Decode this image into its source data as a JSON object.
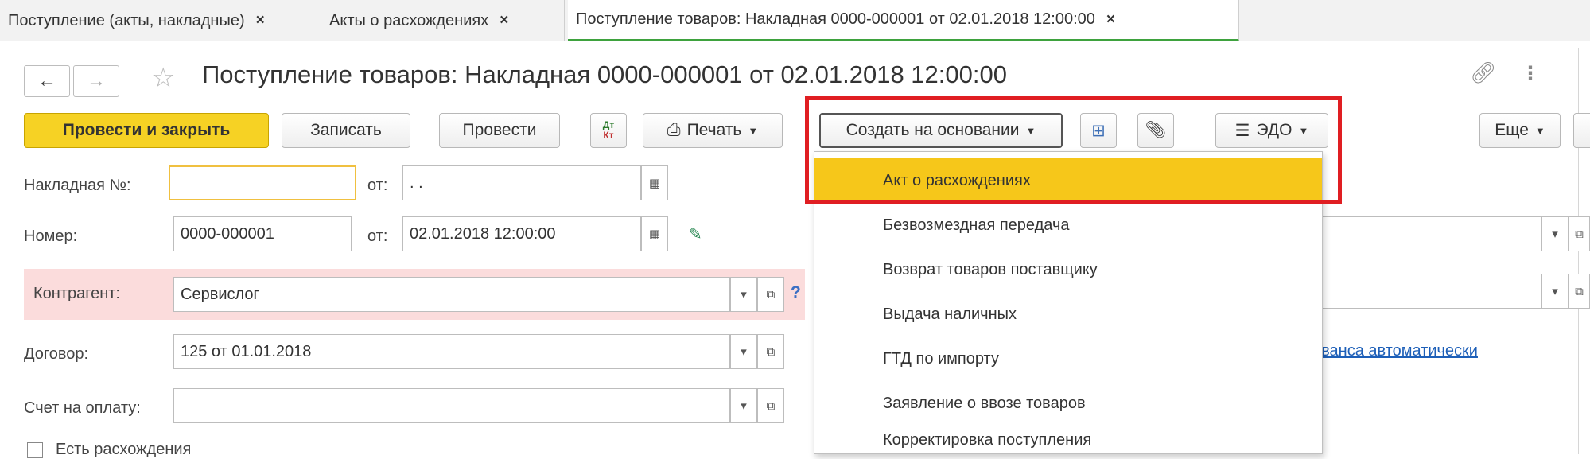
{
  "tabs": [
    {
      "label": "Поступление (акты, накладные)"
    },
    {
      "label": "Акты о расхождениях"
    },
    {
      "label": "Поступление товаров: Накладная 0000-000001 от 02.01.2018 12:00:00"
    }
  ],
  "title": "Поступление товаров: Накладная 0000-000001 от 02.01.2018 12:00:00",
  "toolbar": {
    "post_close": "Провести и закрыть",
    "save": "Записать",
    "post": "Провести",
    "dtkt_top": "Дт",
    "dtkt_bottom": "Кт",
    "print": "Печать",
    "create_based": "Создать на основании",
    "edo": "ЭДО",
    "more": "Еще"
  },
  "form": {
    "invoice_label": "Накладная №:",
    "invoice_value": "",
    "from_label": "от:",
    "invoice_date": " .  .",
    "number_label": "Номер:",
    "number_value": "0000-000001",
    "number_date": "02.01.2018 12:00:00",
    "counterparty_label": "Контрагент:",
    "counterparty_value": "Сервислог",
    "help_mark": "?",
    "contract_label": "Договор:",
    "contract_value": "125 от 01.01.2018",
    "payment_label": "Счет на оплату:",
    "payment_value": "",
    "discrepancy_label": "Есть расхождения",
    "advance_link": "аванса автоматически"
  },
  "menu_items": [
    "Акт о расхождениях",
    "Безвозмездная передача",
    "Возврат товаров поставщику",
    "Выдача наличных",
    "ГТД по импорту",
    "Заявление о ввозе товаров",
    "Корректировка поступления"
  ],
  "colors": {
    "accent_primary": "#f6d224",
    "highlight": "#f6c71a",
    "annotation": "#e01e22",
    "tab_active": "#3ea23e",
    "link": "#1d5fb8"
  }
}
